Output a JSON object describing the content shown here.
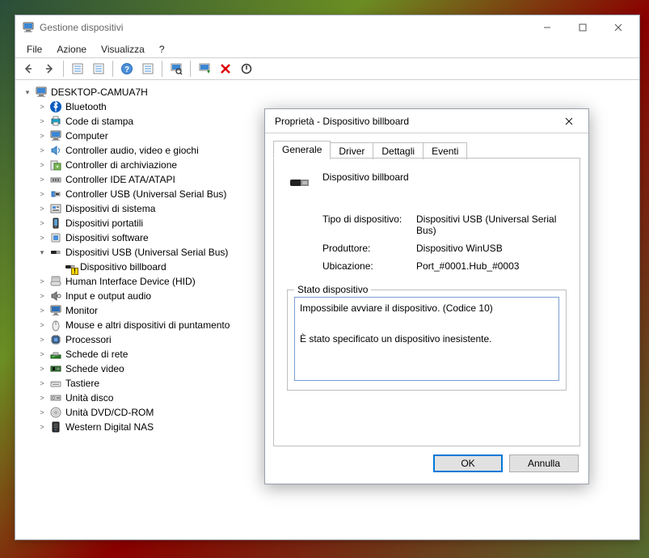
{
  "main": {
    "title": "Gestione dispositivi",
    "menus": [
      "File",
      "Azione",
      "Visualizza",
      "?"
    ]
  },
  "tree": {
    "root": "DESKTOP-CAMUA7H",
    "items": [
      {
        "label": "Bluetooth"
      },
      {
        "label": "Code di stampa"
      },
      {
        "label": "Computer"
      },
      {
        "label": "Controller audio, video e giochi"
      },
      {
        "label": "Controller di archiviazione"
      },
      {
        "label": "Controller IDE ATA/ATAPI"
      },
      {
        "label": "Controller USB (Universal Serial Bus)"
      },
      {
        "label": "Dispositivi di sistema"
      },
      {
        "label": "Dispositivi portatili"
      },
      {
        "label": "Dispositivi software"
      },
      {
        "label": "Dispositivi USB (Universal Serial Bus)"
      },
      {
        "label": "Human Interface Device (HID)"
      },
      {
        "label": "Input e output audio"
      },
      {
        "label": "Monitor"
      },
      {
        "label": "Mouse e altri dispositivi di puntamento"
      },
      {
        "label": "Processori"
      },
      {
        "label": "Schede di rete"
      },
      {
        "label": "Schede video"
      },
      {
        "label": "Tastiere"
      },
      {
        "label": "Unità disco"
      },
      {
        "label": "Unità DVD/CD-ROM"
      },
      {
        "label": "Western Digital NAS"
      }
    ],
    "child": "Dispositivo billboard"
  },
  "dialog": {
    "title": "Proprietà - Dispositivo billboard",
    "tabs": [
      "Generale",
      "Driver",
      "Dettagli",
      "Eventi"
    ],
    "device_name": "Dispositivo billboard",
    "rows": {
      "type_label": "Tipo di dispositivo:",
      "type_value": "Dispositivi USB (Universal Serial Bus)",
      "manu_label": "Produttore:",
      "manu_value": "Dispositivo WinUSB",
      "loc_label": "Ubicazione:",
      "loc_value": "Port_#0001.Hub_#0003"
    },
    "status_legend": "Stato dispositivo",
    "status_text": "Impossibile avviare il dispositivo. (Codice 10)\n\nÈ stato specificato un dispositivo inesistente.",
    "ok": "OK",
    "cancel": "Annulla"
  }
}
